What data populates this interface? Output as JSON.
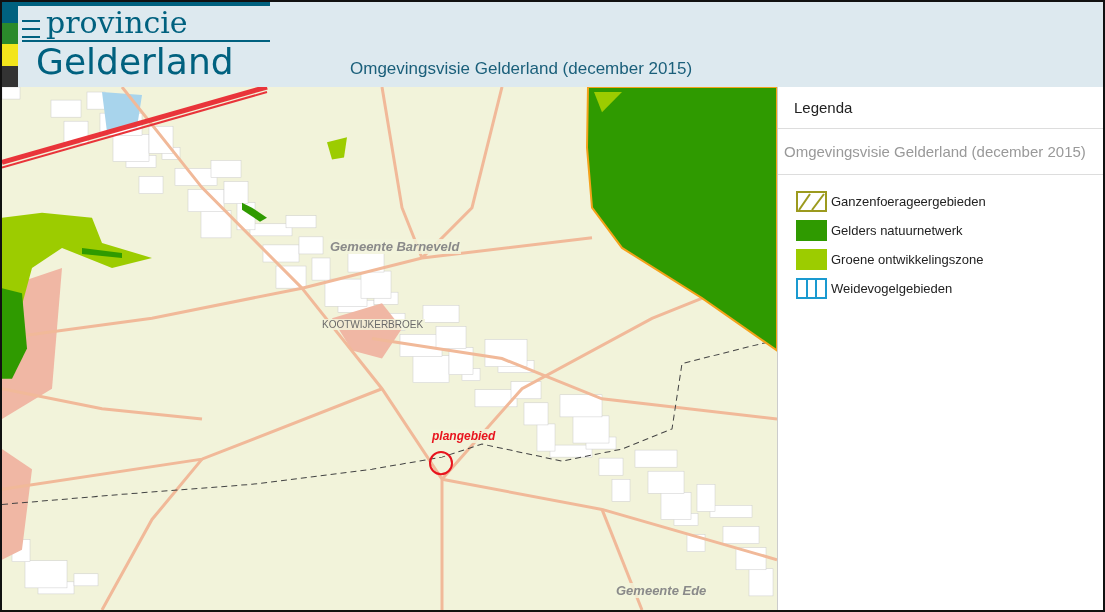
{
  "header": {
    "logo_top": "provincie",
    "logo_bottom": "Gelderland",
    "title": "Omgevingsvisie Gelderland (december 2015)"
  },
  "map": {
    "labels": [
      {
        "kind": "municipality",
        "text": "Gemeente  Barneveld"
      },
      {
        "kind": "place",
        "text": "KOOTWIJKERBROEK"
      },
      {
        "kind": "marker",
        "text": "plangebied"
      },
      {
        "kind": "municipality",
        "text": "Gemeente  Ede"
      }
    ]
  },
  "legend": {
    "title": "Legenda",
    "layer": "Omgevingsvisie Gelderland (december 2015)",
    "items": [
      {
        "kind": "hatched",
        "label": "Ganzenfoerageergebieden",
        "color": "#9c9a1e"
      },
      {
        "kind": "solid",
        "label": "Gelders natuurnetwerk",
        "color": "#2f9a00"
      },
      {
        "kind": "solid",
        "label": "Groene ontwikkelingszone",
        "color": "#9ccc00"
      },
      {
        "kind": "striped",
        "label": "Weidevogelgebieden",
        "color": "#1a9ad0"
      }
    ]
  }
}
